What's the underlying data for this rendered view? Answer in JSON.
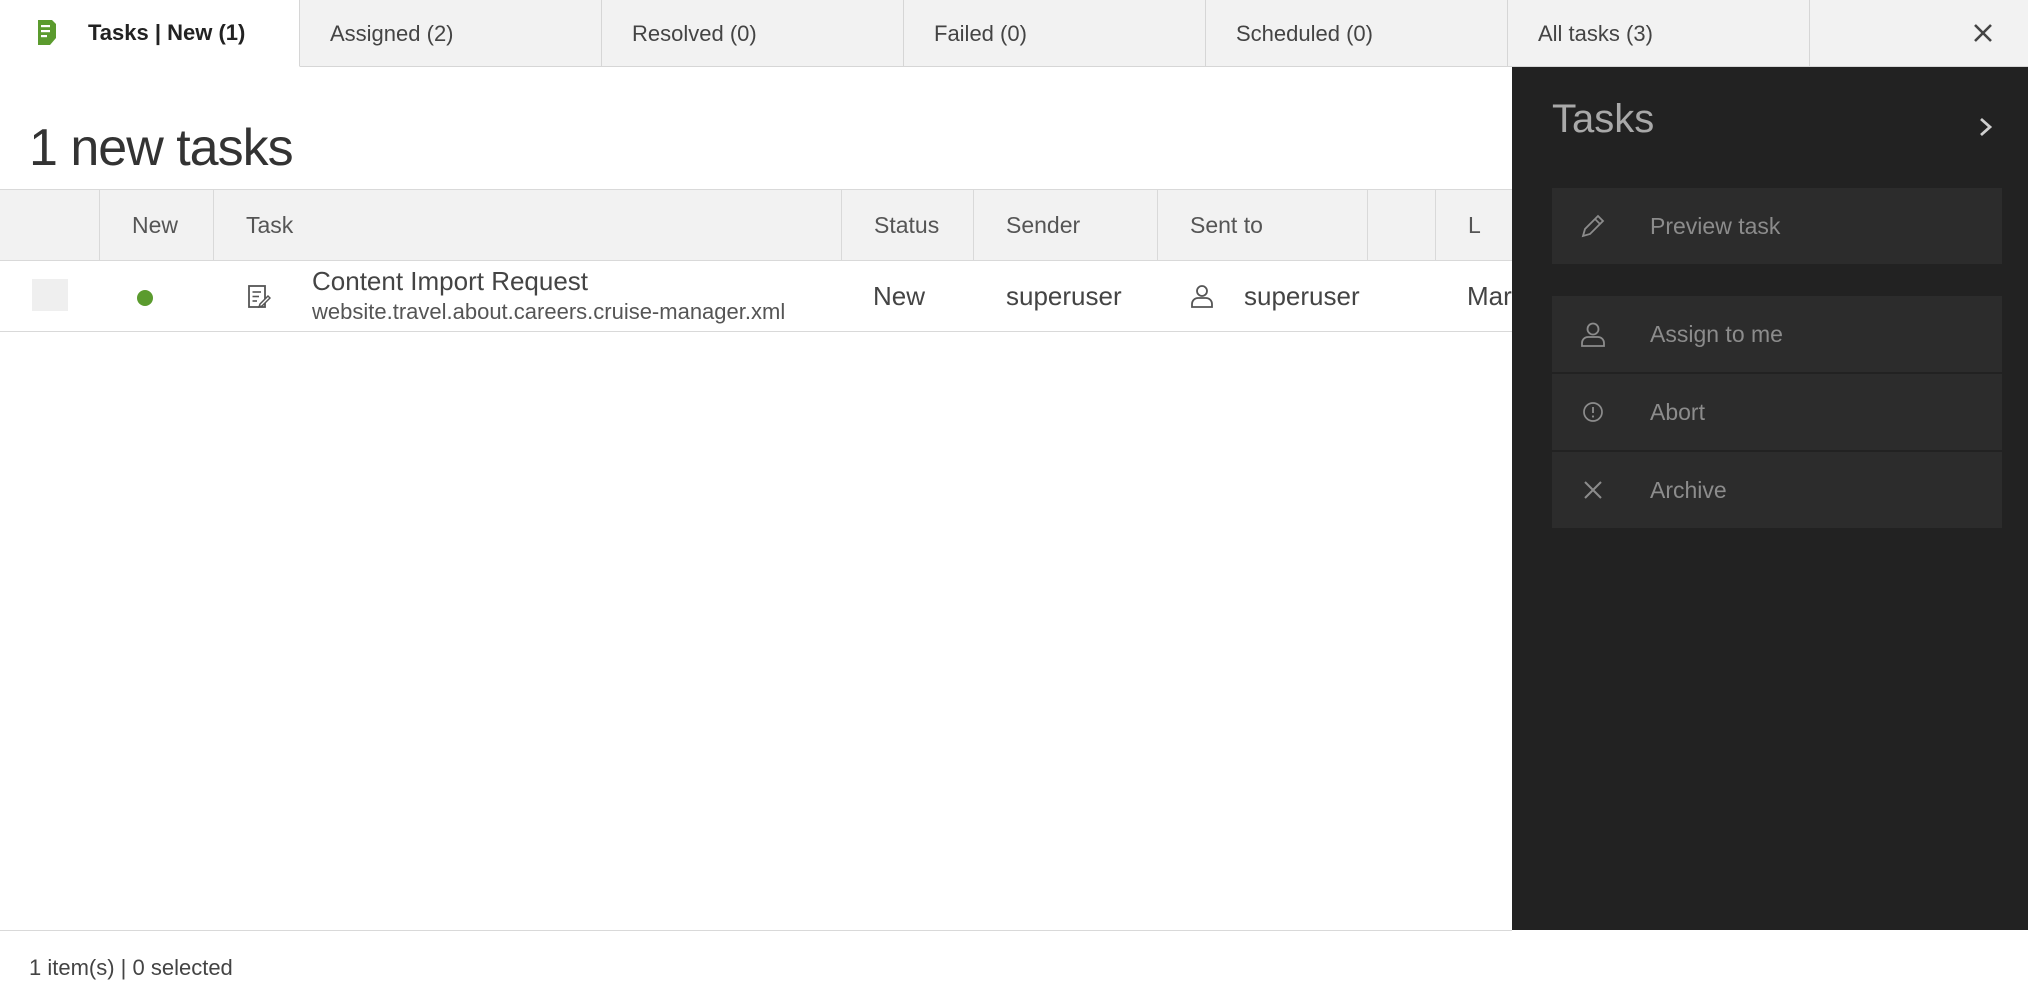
{
  "tabs": [
    {
      "label": "Tasks | New (1)",
      "active": true
    },
    {
      "label": "Assigned (2)"
    },
    {
      "label": "Resolved (0)"
    },
    {
      "label": "Failed (0)"
    },
    {
      "label": "Scheduled (0)"
    },
    {
      "label": "All tasks (3)"
    }
  ],
  "icons": {
    "tasks_app": "tasks-app-icon",
    "close": "close-icon",
    "task_type": "task-document-icon",
    "user": "user-icon",
    "chevron": "chevron-right-icon",
    "pencil": "pencil-icon",
    "abort": "info-circle-icon",
    "archive": "close-icon"
  },
  "colors": {
    "accent_green": "#5b9b2e",
    "panel_bg": "#222222",
    "action_bg": "#2c2c2c"
  },
  "main": {
    "title": "1 new tasks"
  },
  "table": {
    "columns": [
      "New",
      "Task",
      "Status",
      "Sender",
      "Sent to",
      "",
      "L"
    ],
    "rows": [
      {
        "task_title": "Content Import Request",
        "task_path": "website.travel.about.careers.cruise-manager.xml",
        "status": "New",
        "sender": "superuser",
        "sent_to": "superuser",
        "last_col_partial": "Mar"
      }
    ]
  },
  "footer": {
    "summary": "1 item(s) | 0 selected"
  },
  "panel": {
    "title": "Tasks",
    "actions": [
      {
        "label": "Preview task"
      },
      {
        "label": "Assign to me"
      },
      {
        "label": "Abort"
      },
      {
        "label": "Archive"
      }
    ]
  }
}
